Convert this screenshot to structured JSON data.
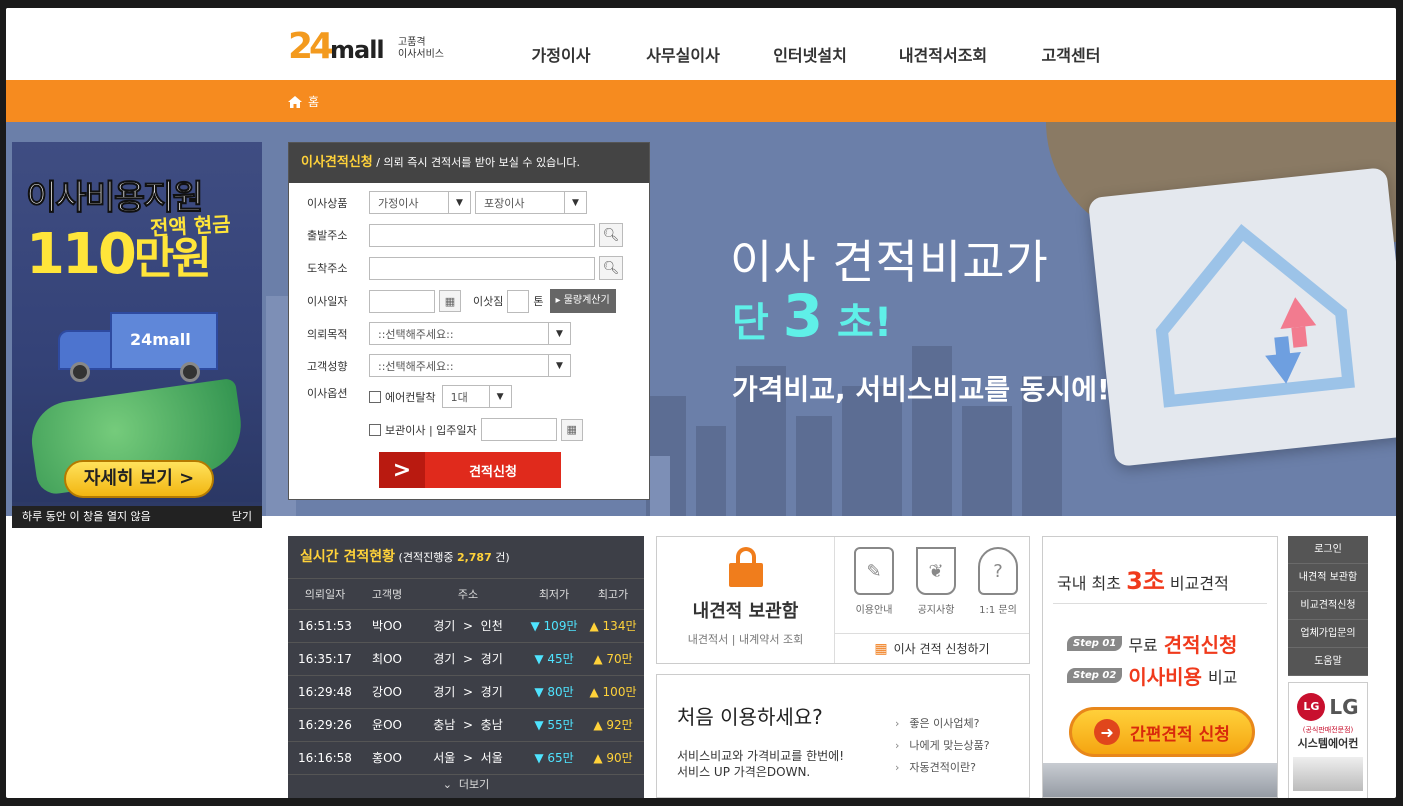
{
  "header": {
    "logo_number": "24",
    "logo_text": "mall",
    "logo_sub1": "고품격",
    "logo_sub2": "이사서비스",
    "nav": [
      "가정이사",
      "사무실이사",
      "인터넷설치",
      "내견적서조회",
      "고객센터"
    ]
  },
  "breadcrumb": {
    "home": "홈"
  },
  "hero": {
    "title": "이사 견적비교가",
    "sub_pre": "단 ",
    "sub_big": "3",
    "sub_post": " 초!",
    "sub2": "가격비교, 서비스비교를 동시에!",
    "slides": 3,
    "active_slide": 2
  },
  "popup": {
    "line1": "이사비용지원",
    "line2": "전액 현금",
    "line3_num": "110",
    "line3_unit": "만원",
    "truck_label": "24mall",
    "button": "자세히 보기 >",
    "footer_text": "하루 동안 이 창을 열지 않음",
    "close": "닫기"
  },
  "form": {
    "title": "이사견적신청",
    "subtitle": " / 의뢰 즉시 견적서를 받아 보실 수 있습니다.",
    "labels": {
      "product": "이사상품",
      "from": "출발주소",
      "to": "도착주소",
      "date": "이사일자",
      "load": "이삿짐",
      "ton": "톤",
      "purpose": "의뢰목적",
      "customer": "고객성향",
      "options": "이사옵션"
    },
    "product_type": "가정이사",
    "pack_type": "포장이사",
    "calc_button": "물량계산기",
    "purpose_value": "::선택해주세요::",
    "customer_value": "::선택해주세요::",
    "aircon_label": "에어컨탈착",
    "aircon_qty": "1대",
    "storage_label": "보관이사 | 입주일자",
    "submit": "견적신청"
  },
  "live": {
    "title": "실시간 견적현황",
    "count_prefix": "(견적진행중 ",
    "count": "2,787",
    "count_suffix": " 건)",
    "columns": [
      "의뢰일자",
      "고객명",
      "주소",
      "최저가",
      "최고가"
    ],
    "rows": [
      {
        "time": "16:51:53",
        "name": "박OO",
        "from": "경기",
        "to": "인천",
        "low": "109만",
        "high": "134만"
      },
      {
        "time": "16:35:17",
        "name": "최OO",
        "from": "경기",
        "to": "경기",
        "low": "45만",
        "high": "70만"
      },
      {
        "time": "16:29:48",
        "name": "강OO",
        "from": "경기",
        "to": "경기",
        "low": "80만",
        "high": "100만"
      },
      {
        "time": "16:29:26",
        "name": "윤OO",
        "from": "충남",
        "to": "충남",
        "low": "55만",
        "high": "92만"
      },
      {
        "time": "16:16:58",
        "name": "홍OO",
        "from": "서울",
        "to": "서울",
        "low": "65만",
        "high": "90만"
      }
    ],
    "more": "더보기"
  },
  "box": {
    "title": "내견적 보관함",
    "sub": "내견적서 | 내계약서 조회",
    "icons": [
      "이용안내",
      "공지사항",
      "1:1 문의"
    ],
    "apply": "이사 견적 신청하기"
  },
  "first": {
    "title": "처음 이용하세요?",
    "desc1": "서비스비교와 가격비교를 한번에!",
    "desc2": "서비스 UP 가격은DOWN.",
    "links": [
      "좋은 이사업체?",
      "나에게 맞는상품?",
      "자동견적이란?"
    ]
  },
  "promo": {
    "t1_pre": "국내 최초 ",
    "t1_em": "3초",
    "t1_post": " 비교견적",
    "step1_tag": "Step 01",
    "step1_pre": "무료 ",
    "step1_em": "견적신청",
    "step2_tag": "Step 02",
    "step2_em": "이사비용",
    "step2_post": " 비교",
    "button": "간편견적 신청"
  },
  "quick": {
    "items": [
      "로그인",
      "내견적 보관함",
      "비교견적신청",
      "업체가입문의",
      "도움말"
    ],
    "lg_mark": "LG",
    "lg_text": "LG",
    "lg_note": "(공식판매전문점)",
    "lg_name": "시스템에어컨"
  },
  "colors": {
    "accent": "#f68b1f",
    "low_price": "#4fe4ff",
    "high_price": "#ffd23a",
    "cta": "#e02a1c"
  }
}
